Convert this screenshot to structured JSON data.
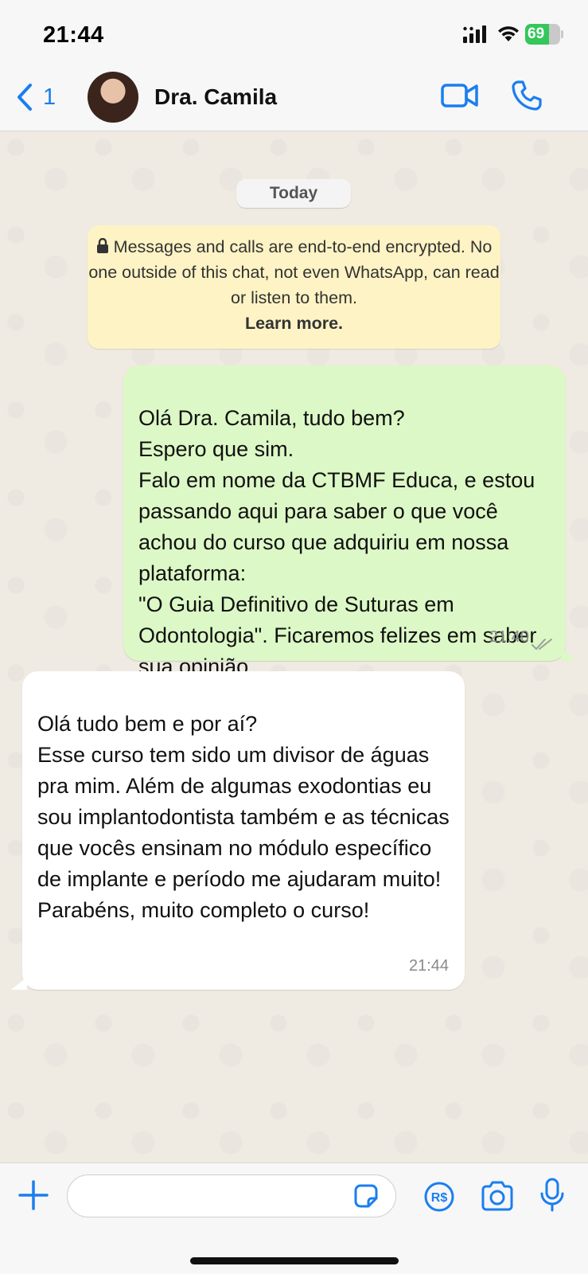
{
  "status_bar": {
    "time": "21:44",
    "battery_level": "69",
    "battery_fraction": 0.69,
    "icons": [
      "signal-icon",
      "wifi-icon",
      "battery-icon"
    ]
  },
  "header": {
    "back_count": "1",
    "contact_name": "Dra. Camila",
    "icons": [
      "chevron-left-icon",
      "video-call-icon",
      "voice-call-icon"
    ]
  },
  "chat": {
    "date_label": "Today",
    "encryption_notice": {
      "text": "Messages and calls are end-to-end encrypted. No one outside of this chat, not even WhatsApp, can read or listen to them.",
      "link": "Learn more."
    },
    "messages": [
      {
        "direction": "outgoing",
        "text": "Olá Dra. Camila, tudo bem?\nEspero que sim.\nFalo em nome da CTBMF Educa, e estou passando aqui para saber o que você achou do curso que adquiriu em nossa plataforma:\n\"O Guia Definitivo de Suturas em Odontologia\". Ficaremos felizes em saber sua opinião.",
        "time": "21:40",
        "status": "read"
      },
      {
        "direction": "incoming",
        "text": "Olá tudo bem e por aí?\nEsse curso tem sido um divisor de águas pra mim. Além de algumas exodontias eu sou implantodontista também e as técnicas que vocês ensinam no módulo específico de implante e período me ajudaram muito!\nParabéns, muito completo o curso!",
        "time": "21:44"
      }
    ]
  },
  "composer": {
    "input_value": "",
    "icons": [
      "plus-icon",
      "sticker-icon",
      "payment-icon",
      "camera-icon",
      "microphone-icon"
    ]
  },
  "colors": {
    "accent": "#1a7ef0",
    "outgoing_bubble": "#dcf8c6",
    "incoming_bubble": "#ffffff",
    "notice_bg": "#fdf3c4",
    "chat_bg": "#efeae2"
  }
}
